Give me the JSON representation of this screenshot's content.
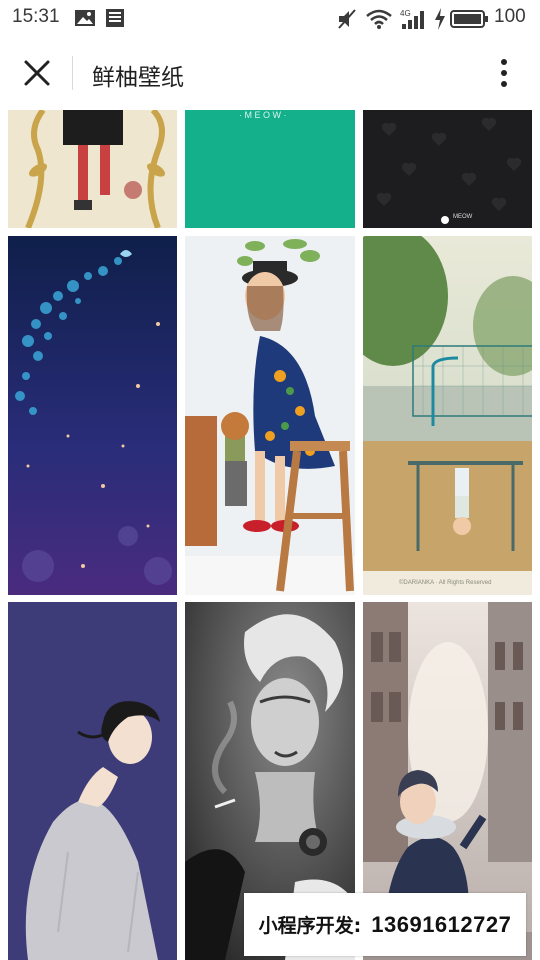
{
  "status_bar": {
    "time": "15:31",
    "battery": "100",
    "network": "4G",
    "icons": [
      "image-icon",
      "news-icon",
      "mute-icon",
      "wifi-icon",
      "signal-icon",
      "charging-icon",
      "battery-icon"
    ]
  },
  "title_bar": {
    "title": "鲜柚壁纸",
    "close_icon": "close-icon",
    "more_icon": "more-vertical-icon"
  },
  "wallpapers": {
    "row1": [
      {
        "name": "wallpaper-soccer-illustration"
      },
      {
        "name": "wallpaper-teal-meow",
        "caption": "· M E O W ·"
      },
      {
        "name": "wallpaper-black-hearts",
        "caption": "MEOW"
      }
    ],
    "row2": [
      {
        "name": "wallpaper-starry-night"
      },
      {
        "name": "wallpaper-girl-on-stool"
      },
      {
        "name": "wallpaper-playground-child",
        "caption": "©DARIANKA · All Rights Reserved"
      }
    ],
    "row3": [
      {
        "name": "wallpaper-woman-profile-illustration"
      },
      {
        "name": "wallpaper-woman-smoking-bw"
      },
      {
        "name": "wallpaper-child-street"
      }
    ]
  },
  "watermark": {
    "label": "小程序开发:",
    "phone": "13691612727"
  },
  "colors": {
    "teal": "#14b08c",
    "title_text": "#1f1f1f",
    "background": "#ffffff"
  }
}
